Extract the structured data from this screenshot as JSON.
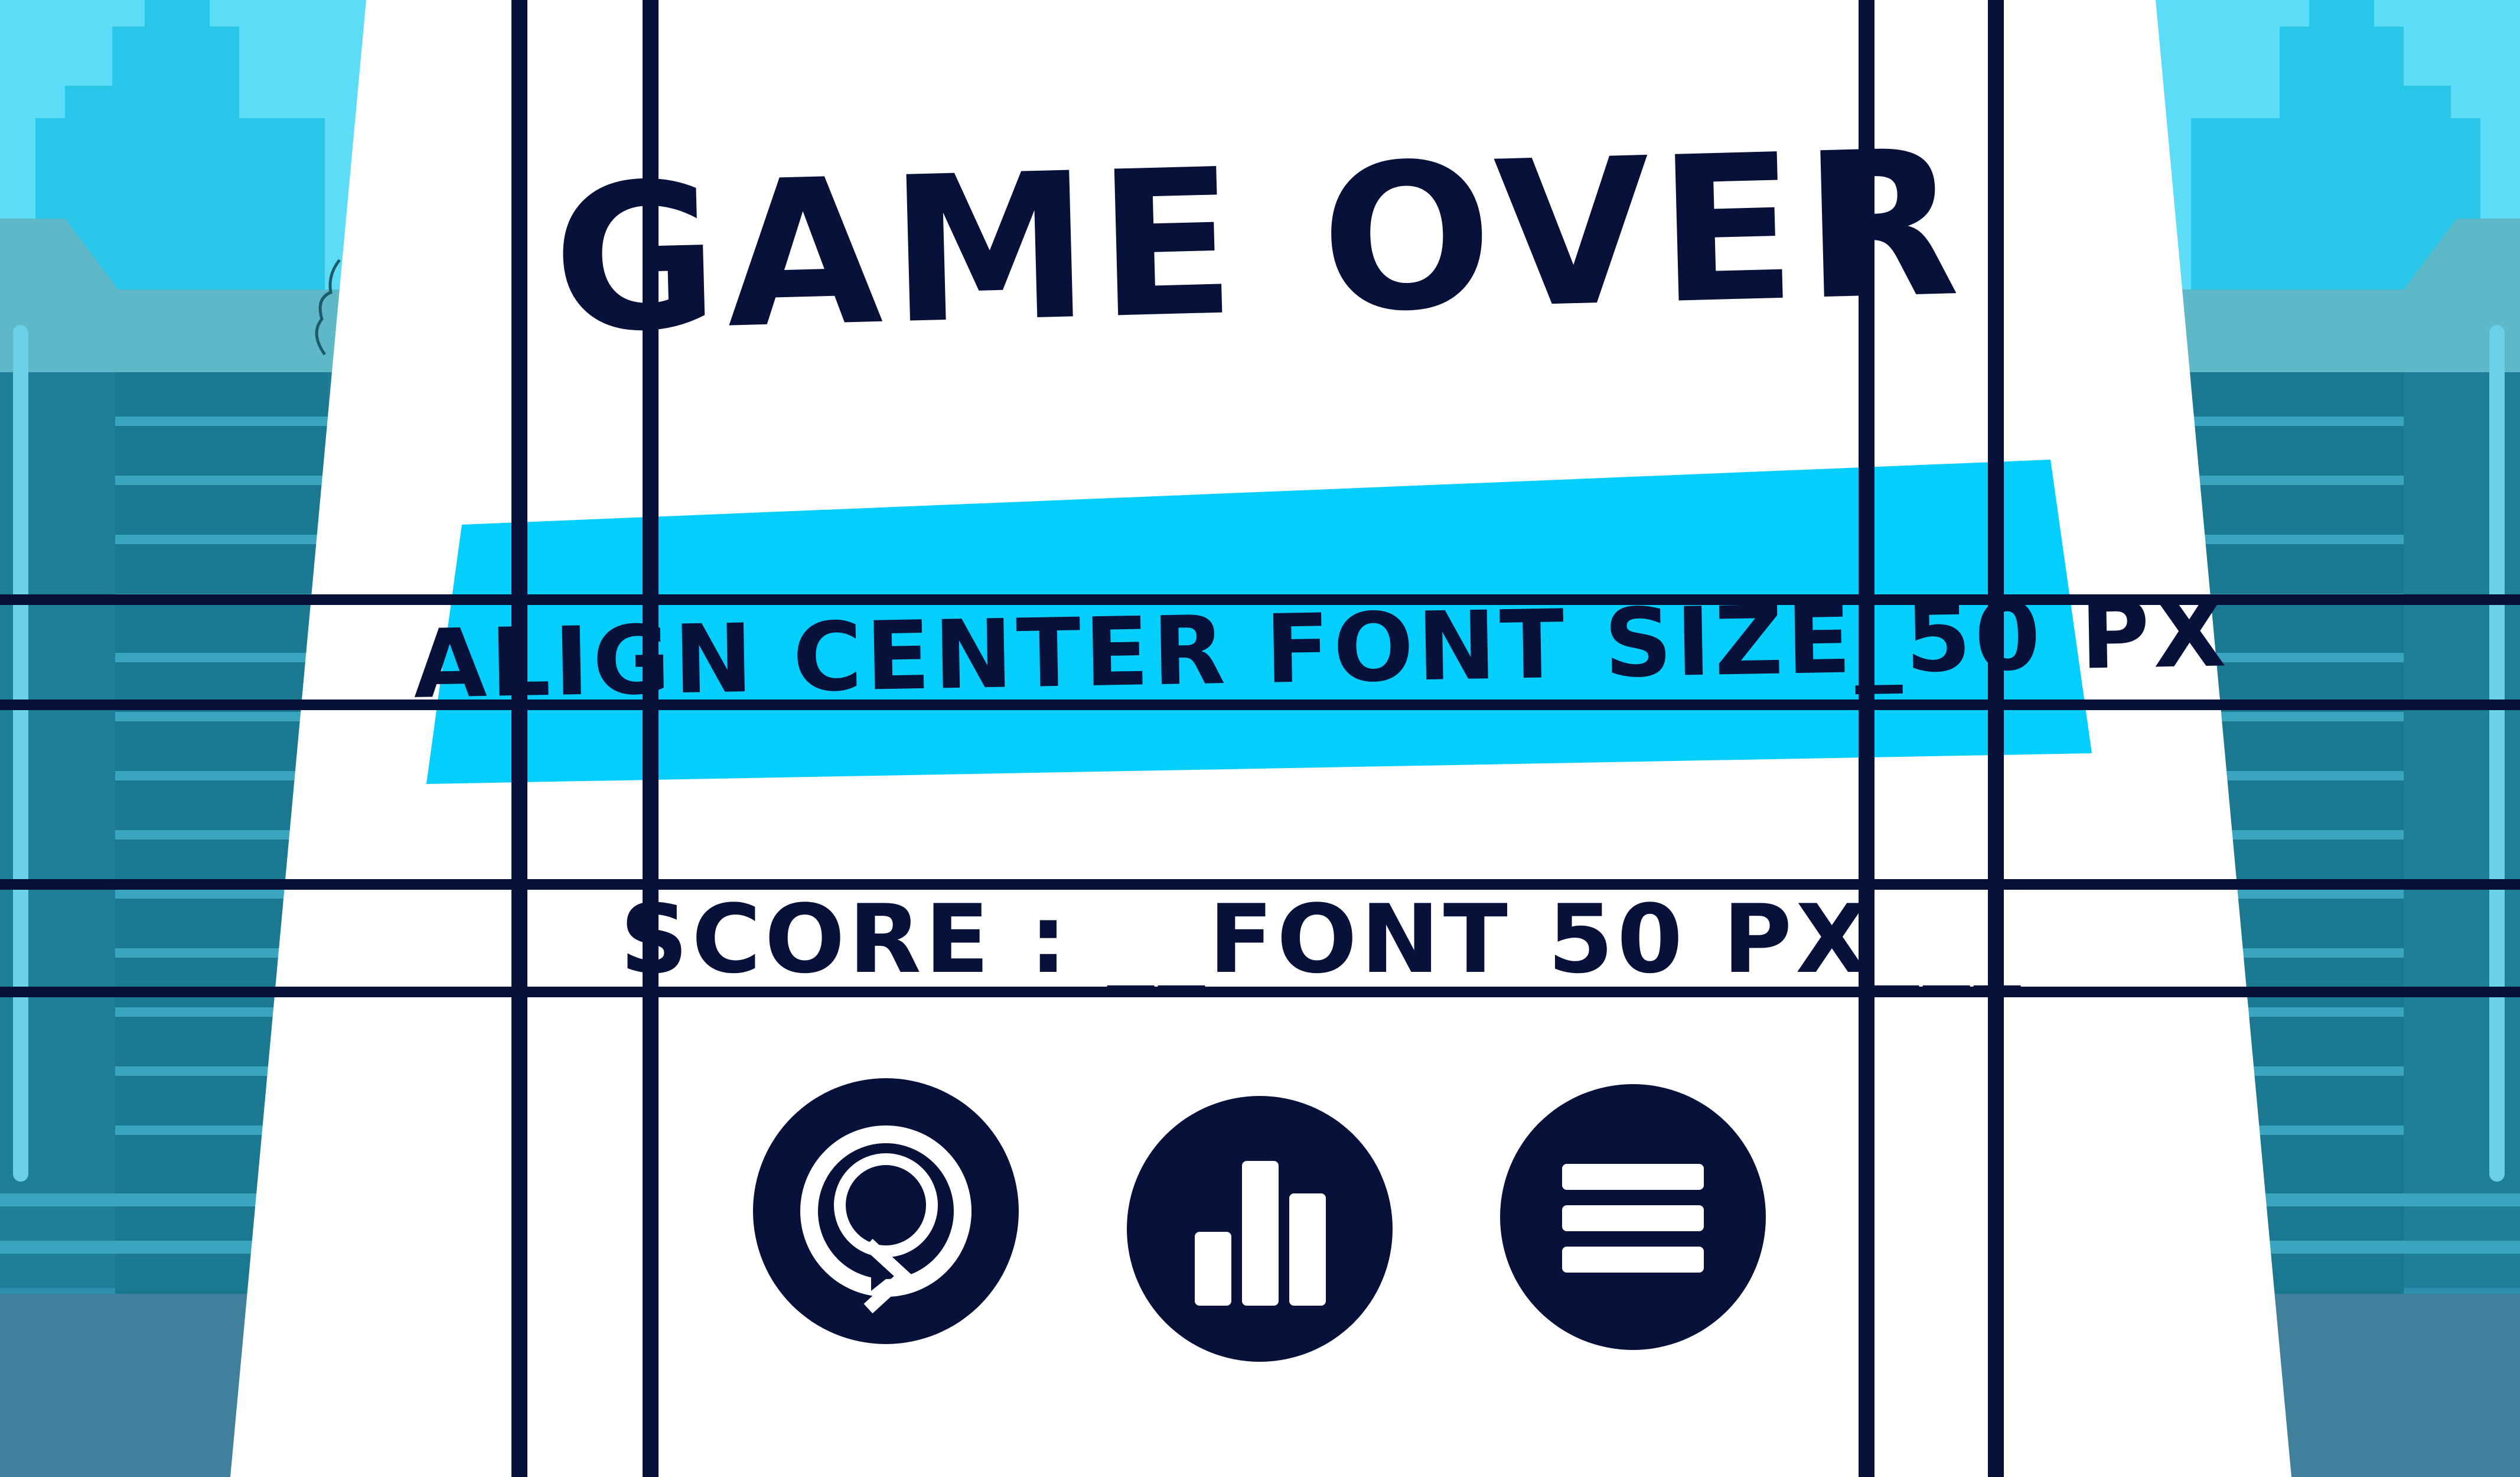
{
  "screen": {
    "title": "GAME OVER",
    "banner_text": "ALIGN CENTER FONT SIZE_50 PX",
    "score_text": "SCORE : __FONT 50 PX___"
  },
  "buttons": [
    {
      "name": "restart-button",
      "icon": "restart-icon"
    },
    {
      "name": "leaderboard-button",
      "icon": "bar-chart-icon"
    },
    {
      "name": "menu-button",
      "icon": "hamburger-menu-icon"
    }
  ],
  "colors": {
    "navy": "#07113a",
    "banner": "#03cefc",
    "sky": "#5cdcf7",
    "tower": "#28c6e8",
    "building": "#2b8fad"
  }
}
